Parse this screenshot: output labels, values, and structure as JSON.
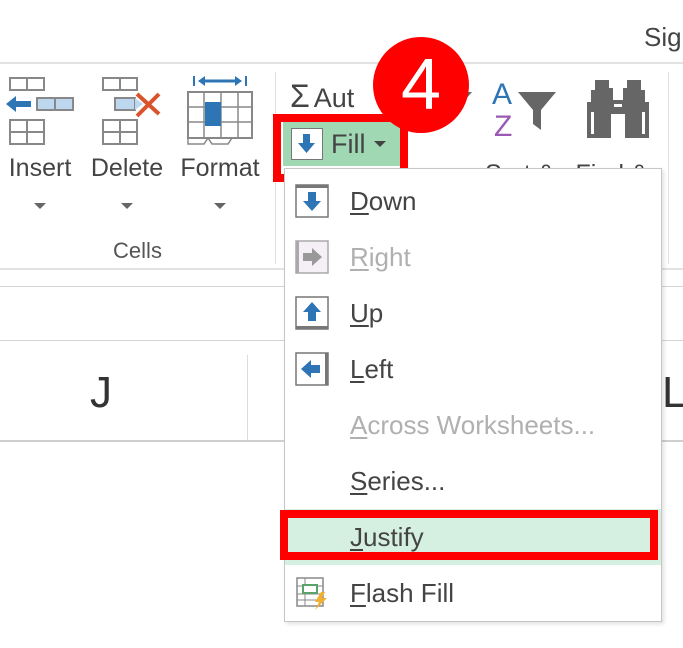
{
  "ribbon": {
    "partial_group_text": "Sig",
    "cells_group": {
      "label": "Cells",
      "buttons": [
        {
          "label": "Insert",
          "icon": "insert-cells-icon"
        },
        {
          "label": "Delete",
          "icon": "delete-cells-icon"
        },
        {
          "label": "Format",
          "icon": "format-cells-icon"
        }
      ]
    },
    "editing_group": {
      "autosum_label": "Aut",
      "autosum_symbol": "Σ",
      "fill_label": "Fill",
      "sort_filter_partial": "Sort &",
      "find_select_partial": "Find &"
    }
  },
  "annotation": {
    "step_number": "4",
    "highlight_color": "#ff0000"
  },
  "columns": [
    "J",
    "L"
  ],
  "fill_menu": {
    "items": [
      {
        "key": "D",
        "rest": "own",
        "label": "Down",
        "icon": "arrow-down-icon",
        "enabled": true
      },
      {
        "key": "R",
        "rest": "ight",
        "label": "Right",
        "icon": "arrow-right-icon",
        "enabled": false
      },
      {
        "key": "U",
        "rest": "p",
        "label": "Up",
        "icon": "arrow-up-icon",
        "enabled": true
      },
      {
        "key": "L",
        "rest": "eft",
        "label": "Left",
        "icon": "arrow-left-icon",
        "enabled": true
      },
      {
        "key": "A",
        "rest": "cross Worksheets...",
        "label": "Across Worksheets...",
        "icon": null,
        "enabled": false
      },
      {
        "key": "S",
        "rest": "eries...",
        "label": "Series...",
        "icon": null,
        "enabled": true
      },
      {
        "key": "J",
        "rest": "ustify",
        "label": "Justify",
        "icon": null,
        "enabled": true,
        "highlighted": true
      },
      {
        "key": "F",
        "rest": "lash Fill",
        "label": "Flash Fill",
        "icon": "flash-fill-icon",
        "enabled": true
      }
    ]
  },
  "colors": {
    "fill_button_bg": "#a0d8b4",
    "hover_row_bg": "#d5efe0",
    "icon_blue": "#2e75b6",
    "badge_red": "#ff0000"
  }
}
